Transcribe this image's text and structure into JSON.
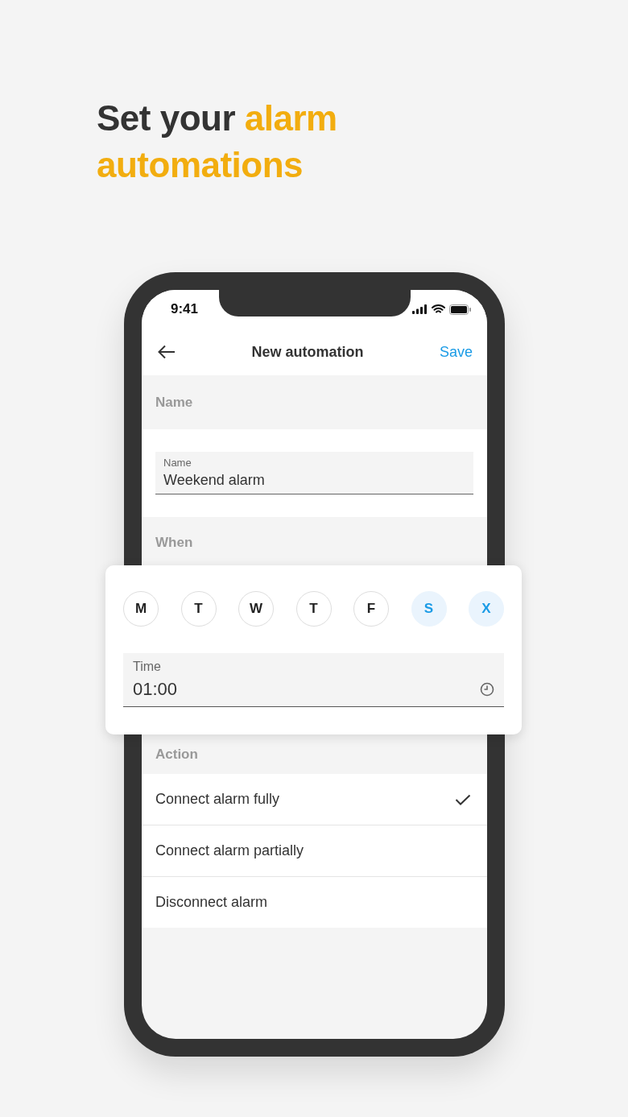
{
  "headline": [
    {
      "text": "Set your ",
      "highlight": false
    },
    {
      "text": "alarm automations",
      "highlight": true
    }
  ],
  "status_bar": {
    "time": "9:41"
  },
  "header": {
    "title": "New automation",
    "action": "Save"
  },
  "name_section": {
    "heading": "Name",
    "field": {
      "label": "Name",
      "value": "Weekend alarm"
    }
  },
  "when_section": {
    "heading": "When",
    "days": [
      {
        "label": "M",
        "selected": false
      },
      {
        "label": "T",
        "selected": false
      },
      {
        "label": "W",
        "selected": false
      },
      {
        "label": "T",
        "selected": false
      },
      {
        "label": "F",
        "selected": false
      },
      {
        "label": "S",
        "selected": true
      },
      {
        "label": "X",
        "selected": true
      }
    ],
    "time_field": {
      "label": "Time",
      "value": "01:00"
    }
  },
  "action_section": {
    "heading": "Action",
    "options": [
      {
        "label": "Connect alarm fully",
        "selected": true
      },
      {
        "label": "Connect alarm partially",
        "selected": false
      },
      {
        "label": "Disconnect alarm",
        "selected": false
      }
    ]
  }
}
